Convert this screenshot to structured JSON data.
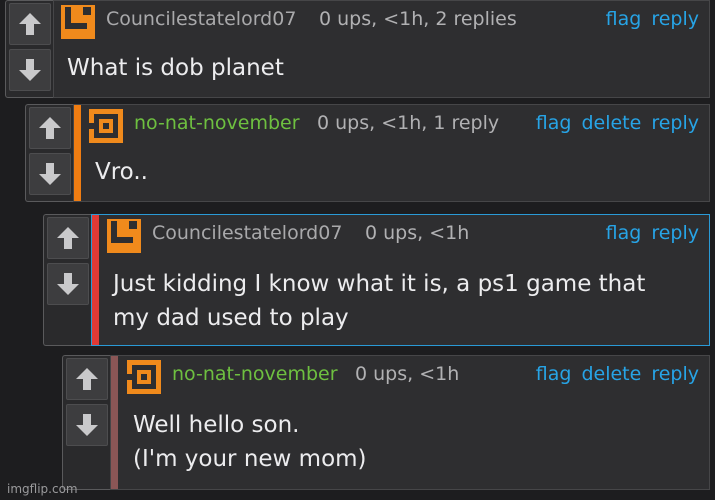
{
  "colors": {
    "link": "#27a4e6",
    "username_default": "#a9a9ab",
    "username_op": "#6ec040",
    "avatar_orange": "#f08a1c",
    "bar_orange": "#f07d12",
    "bar_red": "#e03a36",
    "bar_brown": "#8a5656",
    "highlight_border": "#2a9ad6"
  },
  "comments": [
    {
      "username": "Councilestatelord07",
      "meta": "0 ups, <1h, 2 replies",
      "actions": [
        "flag",
        "reply"
      ],
      "lines": [
        "What is dob planet"
      ]
    },
    {
      "username": "no-nat-november",
      "meta": "0 ups, <1h, 1 reply",
      "actions": [
        "flag",
        "delete",
        "reply"
      ],
      "lines": [
        "Vro.."
      ]
    },
    {
      "username": "Councilestatelord07",
      "meta": "0 ups, <1h",
      "actions": [
        "flag",
        "reply"
      ],
      "lines": [
        "Just kidding I know what it is, a ps1 game that",
        "my dad used to play"
      ]
    },
    {
      "username": "no-nat-november",
      "meta": "0 ups, <1h",
      "actions": [
        "flag",
        "delete",
        "reply"
      ],
      "lines": [
        "Well hello son.",
        "(I'm your new mom)"
      ]
    }
  ],
  "watermark": "imgflip.com"
}
